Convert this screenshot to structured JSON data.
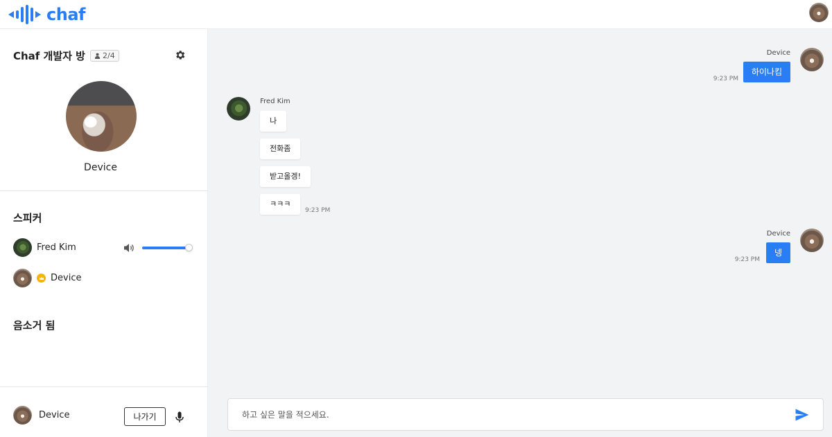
{
  "header": {
    "logo_text": "chaf"
  },
  "room": {
    "title": "Chaf 개발자 방",
    "member_count": "2/4",
    "host_name": "Device"
  },
  "speakers": {
    "title": "스피커",
    "items": [
      {
        "name": "Fred Kim",
        "volume": 0.97
      },
      {
        "name": "Device",
        "is_host": true
      }
    ]
  },
  "muted": {
    "title": "음소거 됨"
  },
  "self": {
    "name": "Device",
    "leave_label": "나가기"
  },
  "messages": [
    {
      "direction": "out",
      "sender": "Device",
      "text": "하이나킴",
      "time": "9:23 PM"
    },
    {
      "direction": "in",
      "sender": "Fred Kim",
      "texts": [
        "나",
        "전화좀",
        "받고올겡!",
        "ㅋㅋㅋ"
      ],
      "time": "9:23 PM"
    },
    {
      "direction": "out",
      "sender": "Device",
      "text": "넹",
      "time": "9:23 PM"
    }
  ],
  "composer": {
    "placeholder": "하고 싶은 말을 적으세요."
  },
  "colors": {
    "accent": "#2a7ef5",
    "chat_bg": "#f2f3f5",
    "crown": "#f5b400"
  }
}
